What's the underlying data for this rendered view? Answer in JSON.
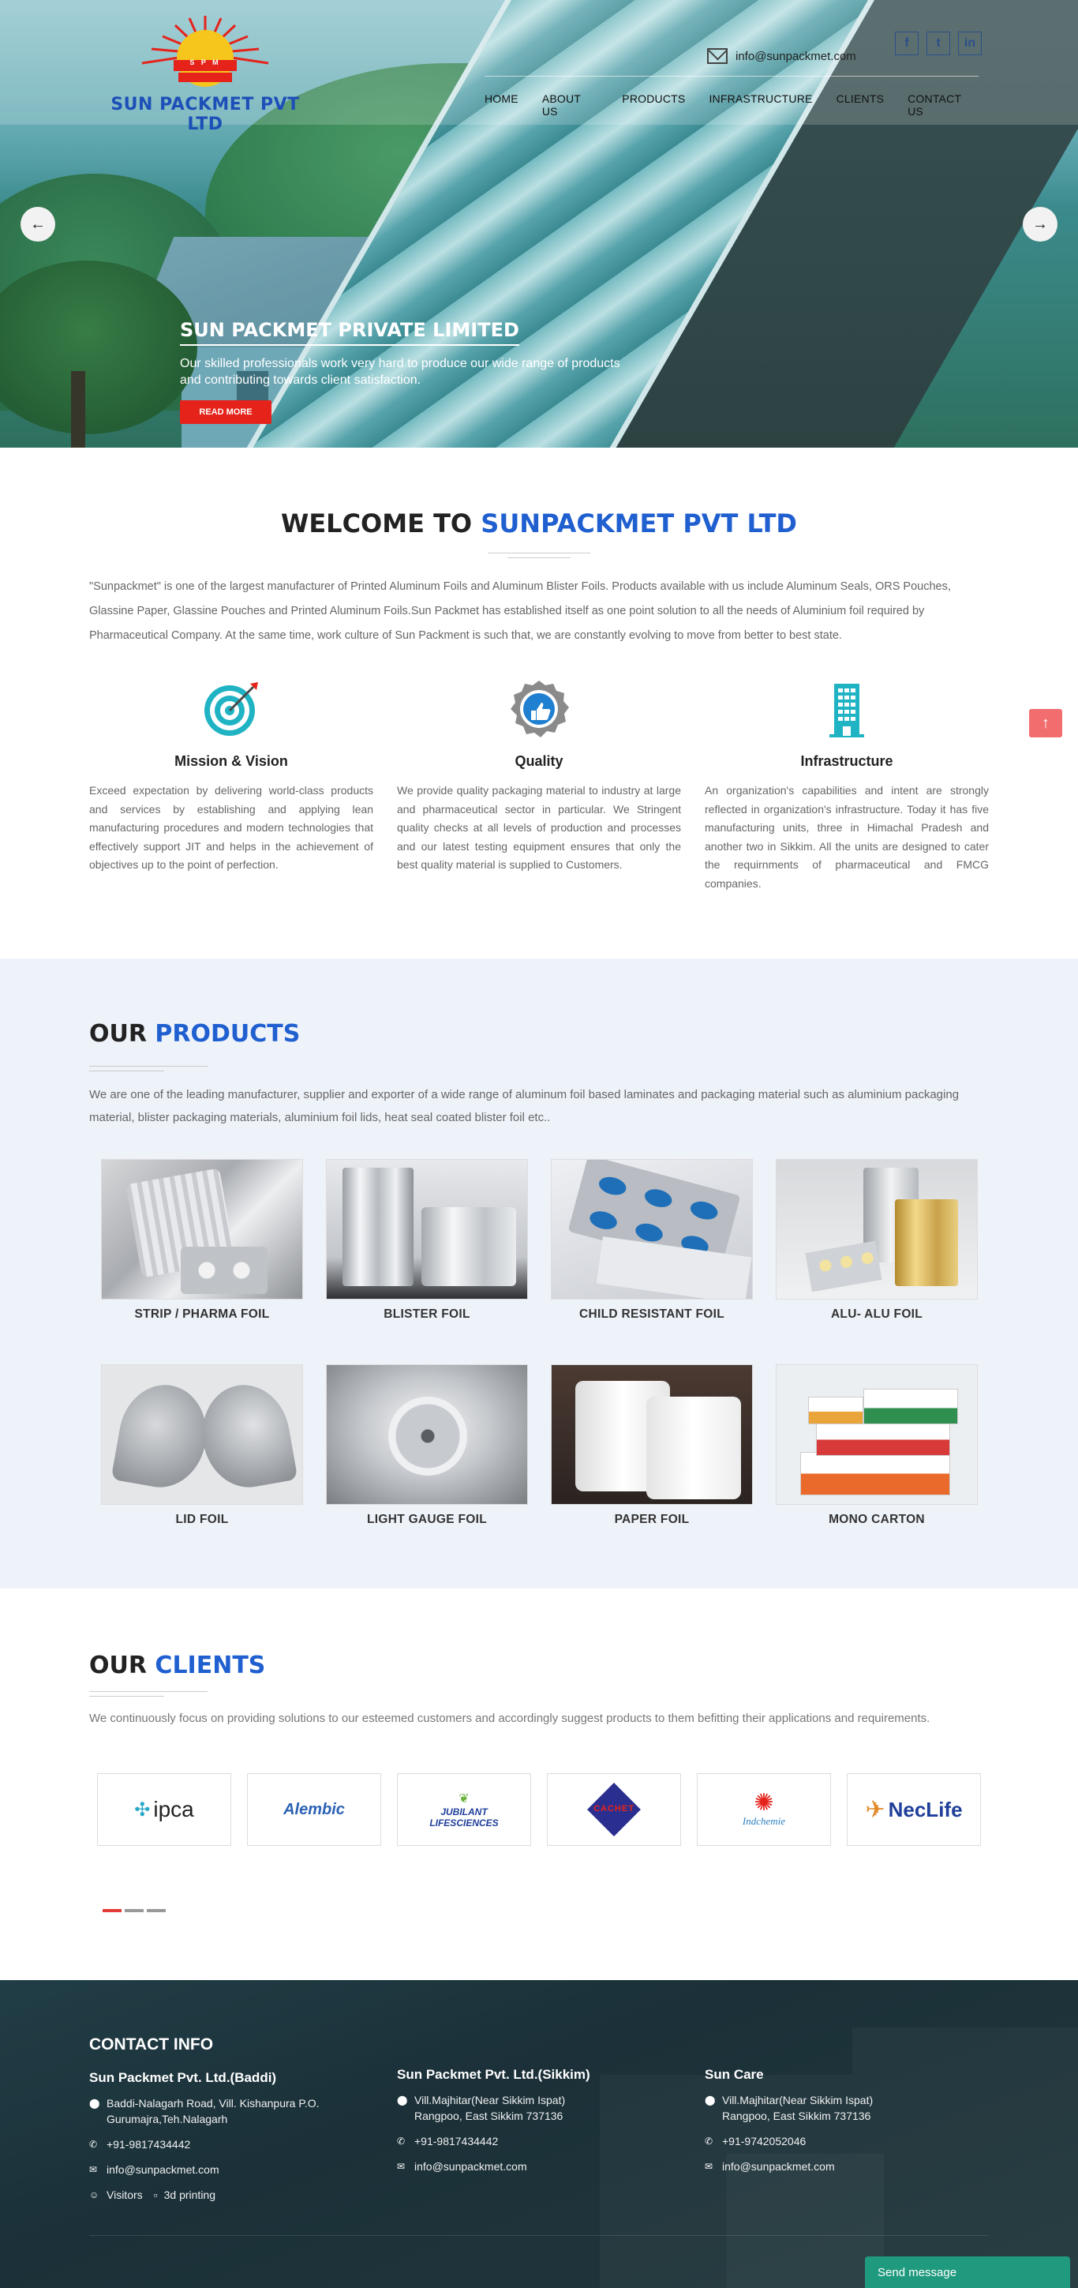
{
  "header": {
    "logo_initials": "S P M",
    "logo_text": "SUN PACKMET PVT LTD",
    "email": "info@sunpackmet.com",
    "social": [
      {
        "icon": "facebook-icon",
        "glyph": "f"
      },
      {
        "icon": "twitter-icon",
        "glyph": "t"
      },
      {
        "icon": "linkedin-icon",
        "glyph": "in"
      }
    ],
    "nav": [
      "HOME",
      "ABOUT US",
      "PRODUCTS",
      "INFRASTRUCTURE",
      "CLIENTS",
      "CONTACT US"
    ]
  },
  "hero": {
    "title": "SUN PACKMET PRIVATE LIMITED",
    "subtitle": "Our skilled professionals work very hard to produce our wide range of products and contributing towards client satisfaction.",
    "button": "READ MORE",
    "prev": "←",
    "next": "→"
  },
  "welcome": {
    "title_dark": "WELCOME TO ",
    "title_blue": "SUNPACKMET PVT LTD",
    "text": "\"Sunpackmet\" is one of the largest manufacturer of Printed Aluminum Foils and Aluminum Blister Foils. Products available with us include Aluminum Seals, ORS Pouches, Glassine Paper, Glassine Pouches and Printed Aluminum Foils.Sun Packmet has established itself as one point solution to all the needs of Aluminium foil required by Pharmaceutical Company. At the same time, work culture of Sun Packment is such that, we are constantly evolving to move from better to best state."
  },
  "features": [
    {
      "title": "Mission & Vision",
      "icon": "target-icon",
      "text": "Exceed expectation by delivering world-class products and services by establishing and applying lean manufacturing procedures and modern technologies that effectively support JIT and helps in the achievement of objectives up to the point of perfection."
    },
    {
      "title": "Quality",
      "icon": "quality-badge-icon",
      "text": "We provide quality packaging material to industry at large and pharmaceutical sector in particular. We Stringent quality checks at all levels of production and processes and our latest testing equipment ensures that only the best quality material is supplied to Customers."
    },
    {
      "title": "Infrastructure",
      "icon": "building-icon",
      "text": "An organization's capabilities and intent are strongly reflected in organization's infrastructure. Today it has five manufacturing units, three in Himachal Pradesh and another two in Sikkim. All the units are designed to cater the requirnments of pharmaceutical and FMCG companies."
    }
  ],
  "products": {
    "title_dark": "OUR ",
    "title_blue": "PRODUCTS",
    "text": "We are one of the leading manufacturer, supplier and exporter of a wide range of aluminum foil based laminates and packaging material such as aluminium packaging material, blister packaging materials, aluminium foil lids, heat seal coated blister foil etc..",
    "items": [
      "STRIP / PHARMA FOIL",
      "BLISTER FOIL",
      "CHILD RESISTANT FOIL",
      "ALU- ALU FOIL",
      "LID FOIL",
      "LIGHT GAUGE FOIL",
      "PAPER FOIL",
      "MONO CARTON"
    ]
  },
  "clients": {
    "title_dark": "OUR ",
    "title_blue": "CLIENTS",
    "text": "We continuously focus on providing solutions to our esteemed customers and accordingly suggest products to them befitting their applications and requirements.",
    "logos": [
      "ipca",
      "Alembic",
      "JUBILANT LIFESCIENCES",
      "CACHET",
      "Indchemie",
      "NecLife"
    ]
  },
  "footer": {
    "heading": "CONTACT INFO",
    "columns": [
      {
        "name": "Sun Packmet Pvt. Ltd.(Baddi)",
        "address": "Baddi-Nalagarh Road, Vill. Kishanpura P.O. Gurumajra,Teh.Nalagarh",
        "phone": "+91-9817434442",
        "email": "info@sunpackmet.com",
        "visitors": "Visitors",
        "visitors_img_alt": "3d printing"
      },
      {
        "name": "Sun Packmet Pvt. Ltd.(Sikkim)",
        "address": "Vill.Majhitar(Near Sikkim Ispat) Rangpoo, East Sikkim 737136",
        "phone": "+91-9817434442",
        "email": "info@sunpackmet.com"
      },
      {
        "name": "Sun Care",
        "address": "Vill.Majhitar(Near Sikkim Ispat) Rangpoo, East Sikkim 737136",
        "phone": "+91-9742052046",
        "email": "info@sunpackmet.com"
      }
    ],
    "send_message": "Send message"
  },
  "colors": {
    "accent_blue": "#1f5fd0",
    "red": "#e5231b",
    "footer_bg": "#1b3038",
    "chat_green": "#1f9a7e"
  }
}
